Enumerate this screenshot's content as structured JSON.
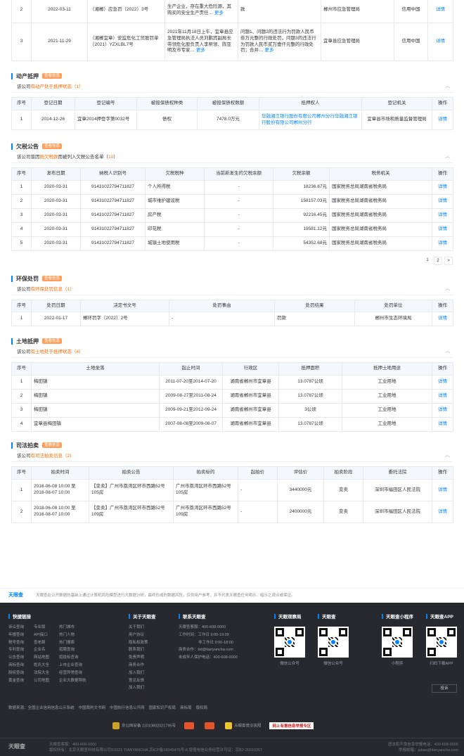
{
  "top_table": {
    "rows": [
      {
        "no": "2",
        "date": "2022-03-11",
        "doc": "（湘郴）应急罚（2022）3号",
        "content": "生产企业，存在重大危险源，其购买的安全生产责任…",
        "content_top": "（2022）3号",
        "result": "款",
        "authority": "郴州市应急管理局",
        "credit": "信用中国",
        "action": "详情"
      },
      {
        "no": "3",
        "date": "2021-11-29",
        "doc": "（湘郴宜章）安监危化工贸股罚单〔2021〕YZXLBL7号",
        "content": "2021年11月18日上午，宜章县应急管理局执法人员刘鹏宾副局长带领危化股负责人李帮领、陈亚明及市专家…",
        "result": "问题1、问题2的违法行为罚款人民币叁万元整的行政处罚，问题3的违法行为罚款人民币贰万壹仟元整的行政处罚；合并…",
        "authority": "宜章县应急管理局",
        "credit": "信用中国",
        "action": "详情"
      }
    ],
    "more_label": "更多"
  },
  "chattel": {
    "title": "动产抵押",
    "badge": "查看信息",
    "summary_prefix": "该公司",
    "summary_hl": "有动产处于抵押状态（1）",
    "headers": [
      "序号",
      "登记日期",
      "登记编号",
      "被担保债权种类",
      "被担保债权数额",
      "抵押权人",
      "登记机关",
      "操作"
    ],
    "rows": [
      {
        "no": "1",
        "date": "2014-12-26",
        "code": "宜章2014押登字第0032号",
        "type": "债权",
        "amount": "7478.0万元",
        "holder": "华融湘江银行股份有限公司郴州分行华融湘江银行股份有限公司郴州分行",
        "org": "宜章县市场和质量监督管理局",
        "action": "详情"
      }
    ]
  },
  "tax": {
    "title": "欠税公告",
    "badge": "查看信息",
    "summary_prefix": "该公司曾因",
    "summary_hl": "拖欠税款",
    "summary_mid": "而被列入欠税公告名单（",
    "summary_count": "10",
    "summary_end": "）",
    "headers": [
      "序号",
      "发布日期",
      "纳税人识别号",
      "欠税税种",
      "当前新发生的欠税余额",
      "欠税余额",
      "税务机关",
      "操作"
    ],
    "rows": [
      {
        "no": "1",
        "date": "2020-03-31",
        "tin": "91431022794711827",
        "kind": "个人所得税",
        "new": "-",
        "balance": "18236.87元",
        "org": "国家税务总局湖南省税务局",
        "action": "详情"
      },
      {
        "no": "2",
        "date": "2020-03-31",
        "tin": "91431022794711827",
        "kind": "城市维护建设税",
        "new": "-",
        "balance": "158157.03元",
        "org": "国家税务总局湖南省税务局",
        "action": "详情"
      },
      {
        "no": "3",
        "date": "2020-03-31",
        "tin": "91431022794711827",
        "kind": "房产税",
        "new": "-",
        "balance": "92216.45元",
        "org": "国家税务总局湖南省税务局",
        "action": "详情"
      },
      {
        "no": "4",
        "date": "2020-03-31",
        "tin": "91431022794711827",
        "kind": "印花税",
        "new": "-",
        "balance": "19581.12元",
        "org": "国家税务总局湖南省税务局",
        "action": "详情"
      },
      {
        "no": "5",
        "date": "2020-03-31",
        "tin": "91431022794711827",
        "kind": "城镇土地使用税",
        "new": "-",
        "balance": "54352.68元",
        "org": "国家税务总局湖南省税务局",
        "action": "详情"
      }
    ],
    "pager": [
      "1",
      "2",
      ">"
    ]
  },
  "env": {
    "title": "环保处罚",
    "badge": "查看信息",
    "summary_prefix": "该公司",
    "summary_hl": "有环保处罚信息（1）",
    "headers": [
      "序号",
      "处罚日期",
      "决定书文号",
      "处罚事由",
      "处罚结果",
      "处罚单位",
      "操作"
    ],
    "rows": [
      {
        "no": "1",
        "date": "2022-01-17",
        "doc": "郴环罚字〔2022〕2号",
        "reason": "-",
        "result": "罚款",
        "org": "郴州市生态环境局",
        "action": "详情"
      }
    ]
  },
  "land": {
    "title": "土地抵押",
    "badge": "查看信息",
    "summary_prefix": "该公司",
    "summary_hl": "有土地处于抵押状态（4）",
    "headers": [
      "序号",
      "土地坐落",
      "起止时间",
      "行政区",
      "抵押面积",
      "抵押土地用途",
      "操作"
    ],
    "rows": [
      {
        "no": "1",
        "loc": "梅田镇",
        "period": "2011-07-20至2014-07-20",
        "region": "湖南省郴州市宜章县",
        "area": "13.0787公顷",
        "use": "工业用地",
        "action": "详情"
      },
      {
        "no": "2",
        "loc": "梅田镇",
        "period": "2009-08-27至2011-08-24",
        "region": "湖南省郴州市宜章县",
        "area": "13.0787公顷",
        "use": "工业用地",
        "action": "详情"
      },
      {
        "no": "3",
        "loc": "梅田镇",
        "period": "2009-09-21至2012-09-24",
        "region": "湖南省郴州市宜章县",
        "area": "3公顷",
        "use": "工业用地",
        "action": "详情"
      },
      {
        "no": "4",
        "loc": "宜章县梅田镇",
        "period": "2007-08-08至2009-08-07",
        "region": "湖南省郴州市宜章县",
        "area": "13.0787公顷",
        "use": "工业用地",
        "action": "详情"
      }
    ]
  },
  "auction": {
    "title": "司法拍卖",
    "badge": "查看信息",
    "summary_prefix": "该公司",
    "summary_hl": "有司法拍卖信息（2）",
    "headers": [
      "序号",
      "拍卖时间",
      "拍卖公告",
      "拍卖标的",
      "起拍价",
      "评估价",
      "拍卖阶段",
      "委托法院",
      "操作"
    ],
    "rows": [
      {
        "no": "1",
        "time": "2018-06-08 10:00 至 2018-08-07 10:00",
        "notice": "【变卖】广州市荔湾区环市西路52号105房",
        "target": "广州市荔湾区环市西路52号105房",
        "start": "-",
        "eval": "3440000元",
        "stage": "变卖",
        "court": "深圳市福田区人民法院",
        "action": "详情"
      },
      {
        "no": "2",
        "time": "2018-06-08 10:00 至 2018-08-07 10:00",
        "notice": "【变卖】广州市荔湾区环市西路52号109房",
        "target": "广州市荔湾区环市西路52号109房",
        "start": "-",
        "eval": "2400000元",
        "stage": "变卖",
        "court": "深圳市福田区人民法院",
        "action": "详情"
      }
    ]
  },
  "disclaimer": {
    "logo": "天眼查",
    "text": "天眼查在公开数据的基础上通过计算机风险模型进行大数据分析，最终形成的数据风险，仅供用户参考，并不代表天眼查任何明示、暗示之观点或保证。"
  },
  "footer": {
    "quick": {
      "title": "快捷链接",
      "col1": [
        "诉讼查询",
        "年报查询",
        "税号查询",
        "专利查询",
        "公告查询",
        "商标查询",
        "股权查询",
        "黄金查询"
      ],
      "col2": [
        "专业版",
        "API接口",
        "查老赖",
        "企业名",
        "网站地图",
        "姓氏大全",
        "法院大全",
        "公司地图"
      ],
      "col3": [
        "热门城市",
        "热门人物",
        "热门搜索",
        "招聘查询",
        "招投标查询",
        "上市企业查询",
        "经营异常查询",
        "企业大数据导航"
      ]
    },
    "about": {
      "title": "关于天眼查",
      "items": [
        "关于我们",
        "用户协议",
        "隐私权政策",
        "联系我们",
        "免责声明",
        "商务合作",
        "加入我们",
        "意见反馈",
        "加入我们"
      ]
    },
    "contact": {
      "title": "联系天眼查",
      "items": [
        "天眼查客服：400-608-0000",
        "工作时间：工作日 9:00-19:00",
        "非工作日 9:00-18:00",
        "商务合作：bd@tianyancha.com",
        "未成年人保护电话：400-608-0000"
      ]
    },
    "qrs": [
      {
        "title": "天眼观察局",
        "cap": "微信公众号"
      },
      {
        "title": "天眼查",
        "cap": "微信公众号"
      },
      {
        "title": "天眼查小程序",
        "cap": "小程序"
      },
      {
        "title": "天眼查APP",
        "cap": "扫码下载APP"
      }
    ],
    "download_btn": "投诉",
    "links": [
      "数据来源：全国企业信用信息公示系统",
      "中国裁判文书网",
      "中国执行信息公开网",
      "国家知识产权局",
      "商标局",
      "版权局"
    ],
    "certs": [
      "京公网安备 11010802021795号",
      "",
      "",
      "天眼查营业执照",
      "网上有害信息举报专区"
    ],
    "bottom_left1": "天眼查客服：400-608-0000",
    "bottom_left2": "版权所有：北京天眼查科技有限公司©2021 TIANYANCHA 京ICP备18045476号-6 增值电信业务经营许可证：京B2-20210267",
    "bottom_right1": "违法和不良信息举报电话：400-608-0000",
    "bottom_right2": "举报邮箱：jubao@tianyancha.com",
    "brand": "天眼查"
  }
}
